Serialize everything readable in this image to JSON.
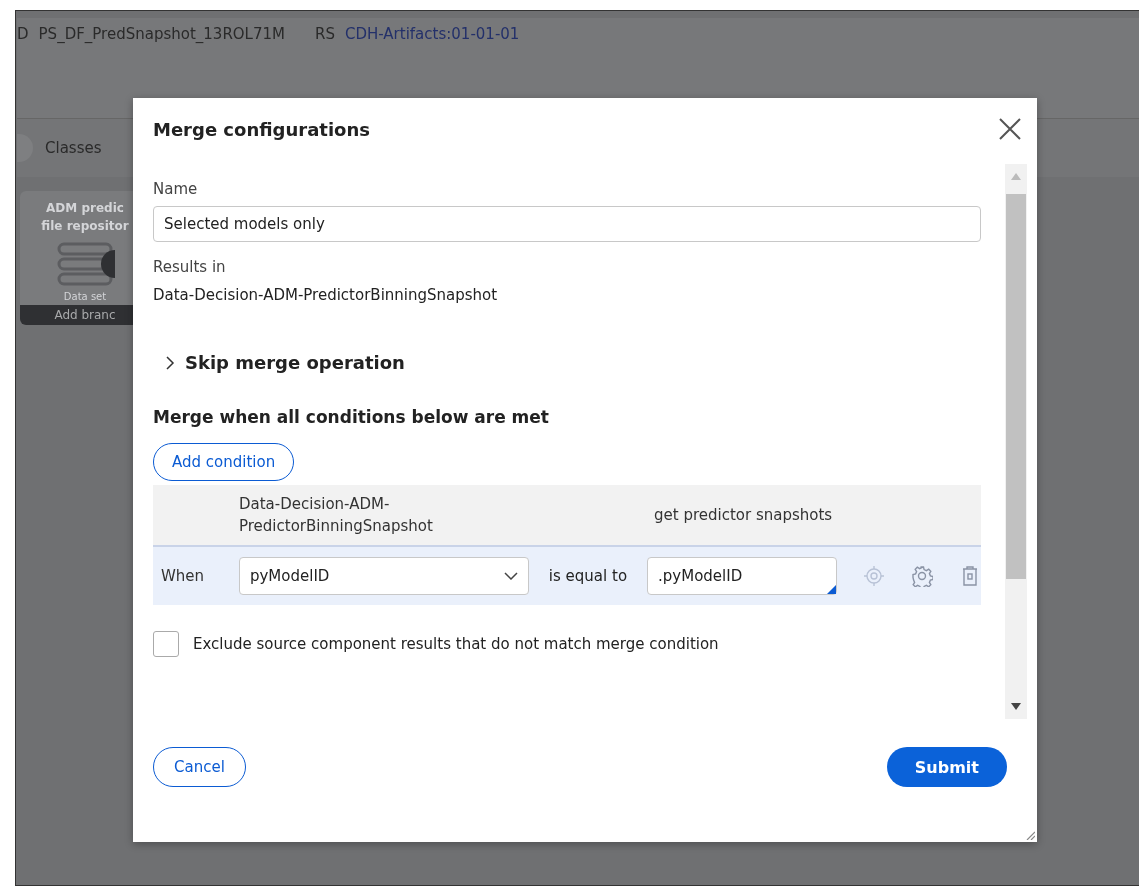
{
  "header": {
    "id_label": "D",
    "id": "PS_DF_PredSnapshot_13ROL71M",
    "rs_label": "RS",
    "ruleset": "CDH-Artifacts:01-01-01"
  },
  "tabs": [
    {
      "label": "Classes"
    }
  ],
  "canvas_card": {
    "title_lines": [
      "ADM predic",
      "file repositor"
    ],
    "type": "Data set",
    "action": "Add branc"
  },
  "dialog": {
    "title": "Merge configurations",
    "name_label": "Name",
    "name_value": "Selected models only",
    "results_label": "Results in",
    "results_value": "Data-Decision-ADM-PredictorBinningSnapshot",
    "skip": {
      "label": "Skip merge operation",
      "expanded": false
    },
    "conditions_heading": "Merge when all conditions below are met",
    "add_button": "Add condition",
    "table": {
      "columns": [
        "Data-Decision-ADM-PredictorBinningSnapshot",
        "get predictor snapshots"
      ],
      "rows": [
        {
          "prefix": "When",
          "left": "pyModelID",
          "operator": "is equal to",
          "right": ".pyModelID"
        }
      ]
    },
    "exclude": {
      "label": "Exclude source component results that do not match merge condition",
      "checked": false
    },
    "cancel": "Cancel",
    "submit": "Submit"
  }
}
